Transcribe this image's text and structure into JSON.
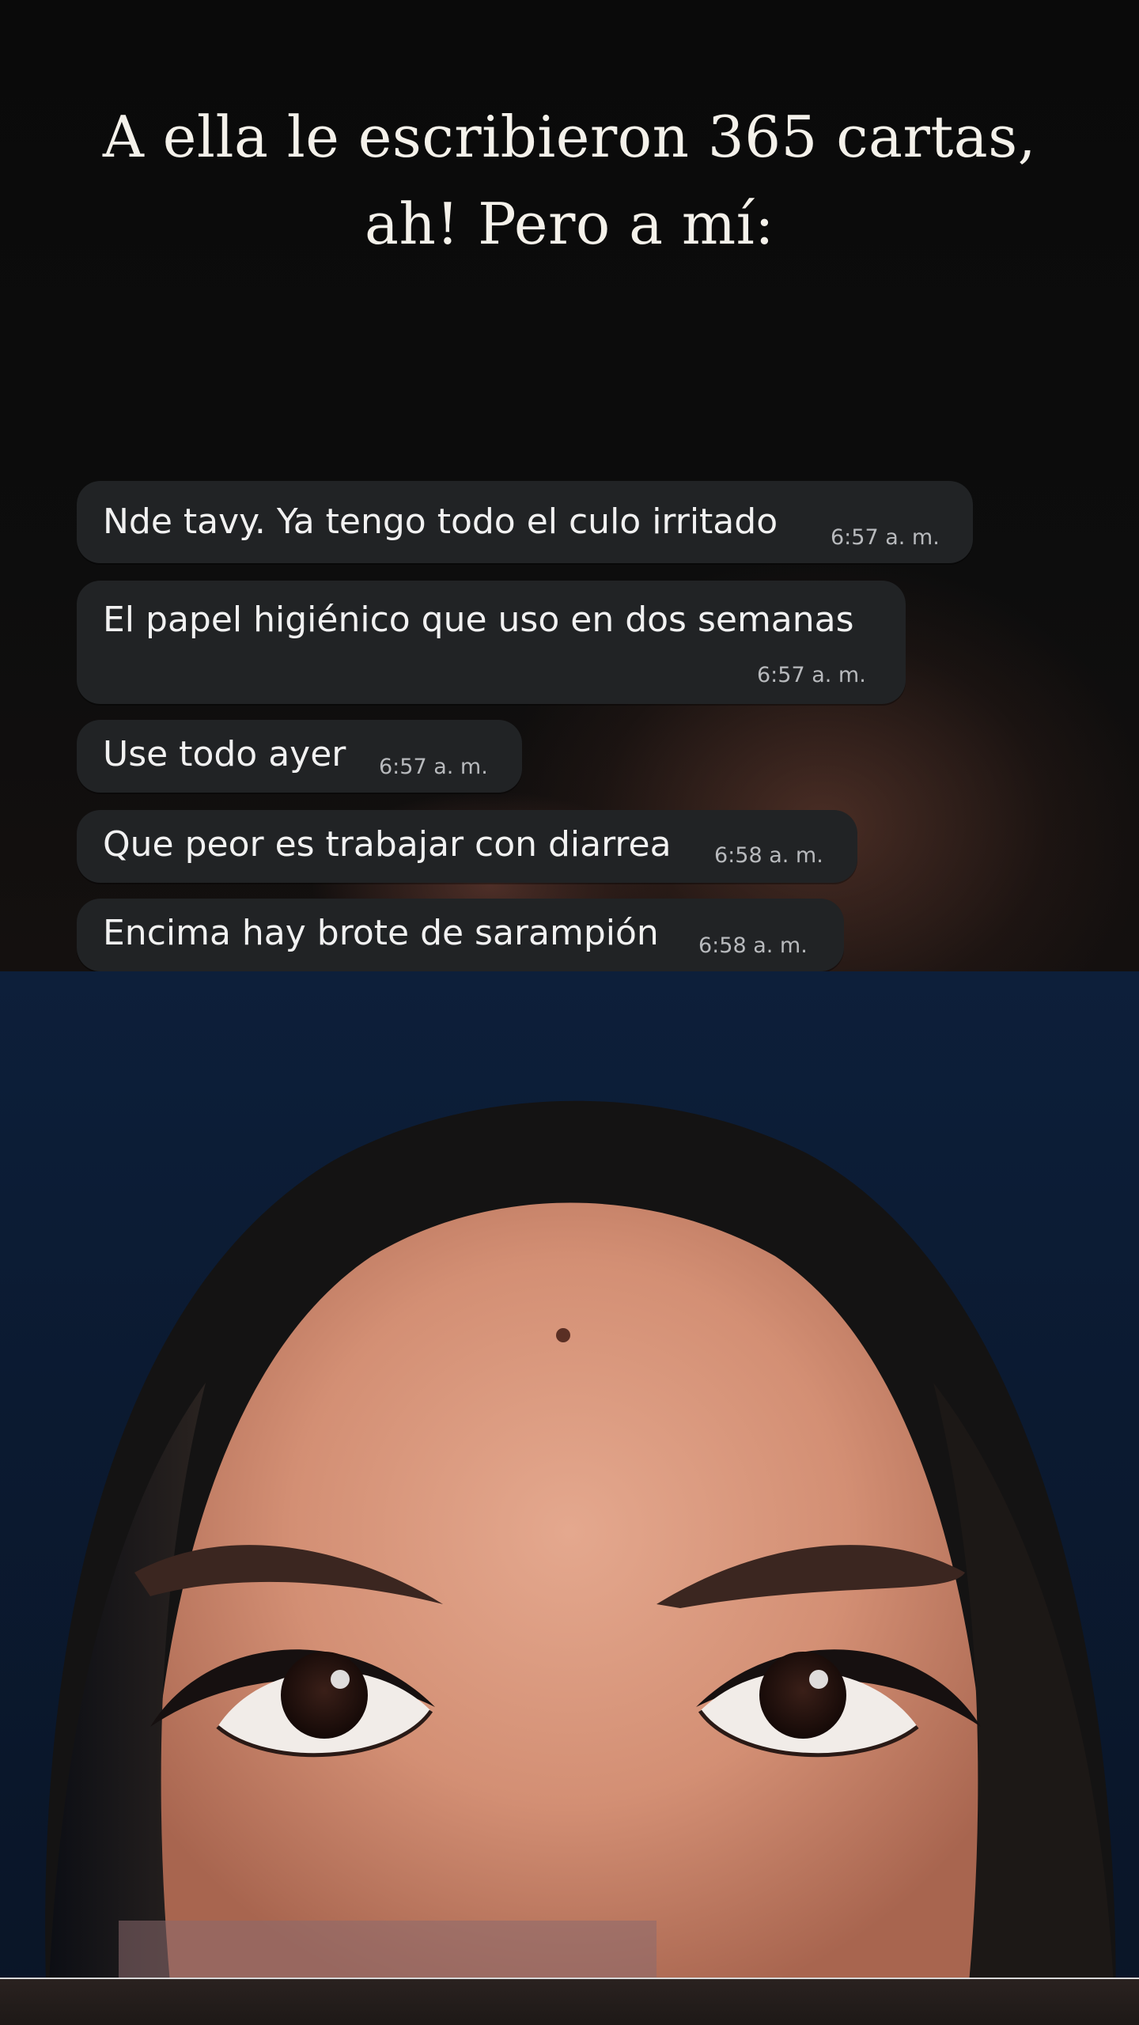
{
  "caption": {
    "line1": "A ella le escribieron 365 cartas,",
    "line2": "ah! Pero a mí:"
  },
  "messages": [
    {
      "text": "Nde tavy. Ya tengo todo el culo irritado",
      "time": "6:57 a. m."
    },
    {
      "text": "El papel higiénico que uso en dos semanas",
      "time": "6:57 a. m."
    },
    {
      "text": "Use todo ayer",
      "time": "6:57 a. m."
    },
    {
      "text": "Que peor es trabajar con diarrea",
      "time": "6:58 a. m."
    },
    {
      "text": "Encima hay brote de sarampión",
      "time": "6:58 a. m."
    }
  ],
  "colors": {
    "bubble": "#212325",
    "timestamp": "#b8babd",
    "photo_background": "#0d1f3a"
  },
  "photo": {
    "subject_icon": "woman-face-looking-up"
  }
}
